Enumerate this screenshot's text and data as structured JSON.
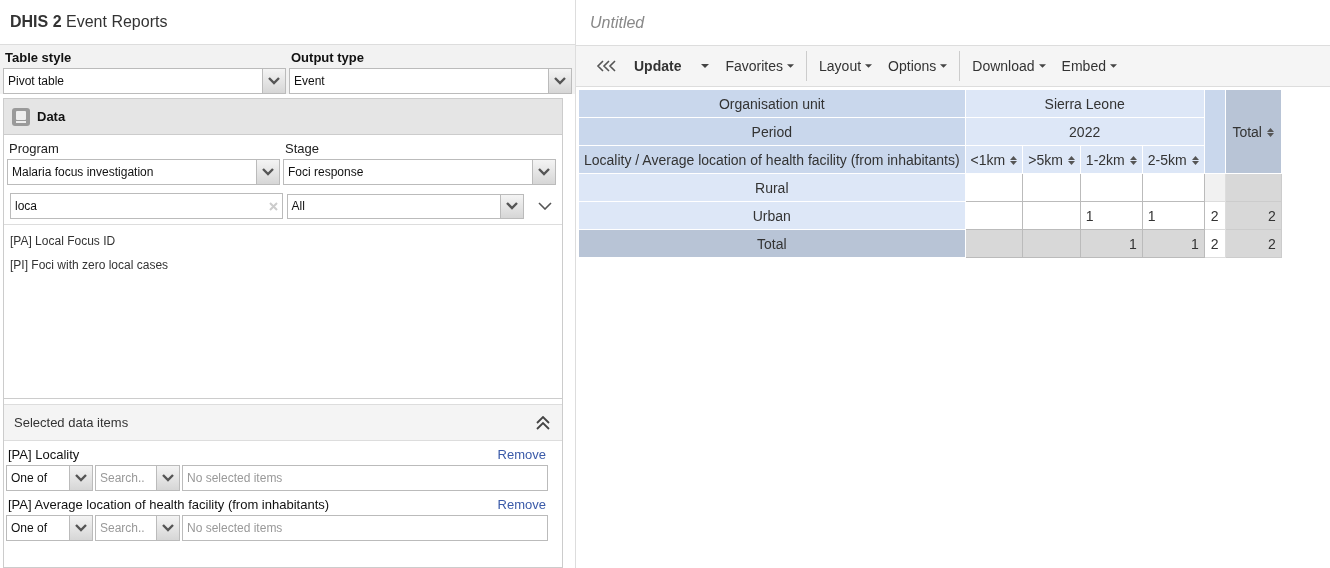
{
  "header": {
    "app_bold": "DHIS 2",
    "app_name": "Event Reports",
    "favorite_title": "Untitled"
  },
  "table_style": {
    "label": "Table style",
    "value": "Pivot table"
  },
  "output_type": {
    "label": "Output type",
    "value": "Event"
  },
  "data_panel": {
    "title": "Data",
    "program": {
      "label": "Program",
      "value": "Malaria focus investigation"
    },
    "stage": {
      "label": "Stage",
      "value": "Foci response"
    },
    "search": {
      "value": "loca"
    },
    "filter": {
      "value": "All"
    },
    "items": [
      "[PA] Local Focus ID",
      "[PI] Foci with zero local cases"
    ]
  },
  "selected_panel": {
    "title": "Selected data items",
    "items": [
      {
        "name": "[PA] Locality",
        "remove": "Remove",
        "operator": "One of",
        "search_placeholder": "Search..",
        "values_placeholder": "No selected items"
      },
      {
        "name": "[PA] Average location of health facility (from inhabitants)",
        "remove": "Remove",
        "operator": "One of",
        "search_placeholder": "Search..",
        "values_placeholder": "No selected items"
      }
    ]
  },
  "toolbar": {
    "groups": [
      [
        {
          "kind": "collapse"
        },
        {
          "kind": "split",
          "label": "Update"
        },
        {
          "kind": "menu",
          "label": "Favorites"
        }
      ],
      [
        {
          "kind": "menu",
          "label": "Layout"
        },
        {
          "kind": "menu",
          "label": "Options"
        }
      ],
      [
        {
          "kind": "menu",
          "label": "Download"
        },
        {
          "kind": "menu",
          "label": "Embed"
        }
      ]
    ]
  },
  "table": {
    "org_label": "Organisation unit",
    "org_value": "Sierra Leone",
    "period_label": "Period",
    "period_value": "2022",
    "dim_label": "Locality / Average location of health facility (from inhabitants)",
    "columns": [
      "<1km",
      ">5km",
      "1-2km",
      "2-5km"
    ],
    "total_label": "Total",
    "rows": [
      {
        "kind": "data",
        "label": "Rural",
        "cells": [
          "",
          "",
          "",
          ""
        ],
        "subtotal": "",
        "total": ""
      },
      {
        "kind": "data",
        "label": "Urban",
        "cells": [
          "",
          "",
          "1",
          "1"
        ],
        "subtotal": "2",
        "total": "2"
      },
      {
        "kind": "total",
        "label": "Total",
        "cells": [
          "",
          "",
          "1",
          "1"
        ],
        "subtotal": "2",
        "total": "2"
      }
    ]
  }
}
